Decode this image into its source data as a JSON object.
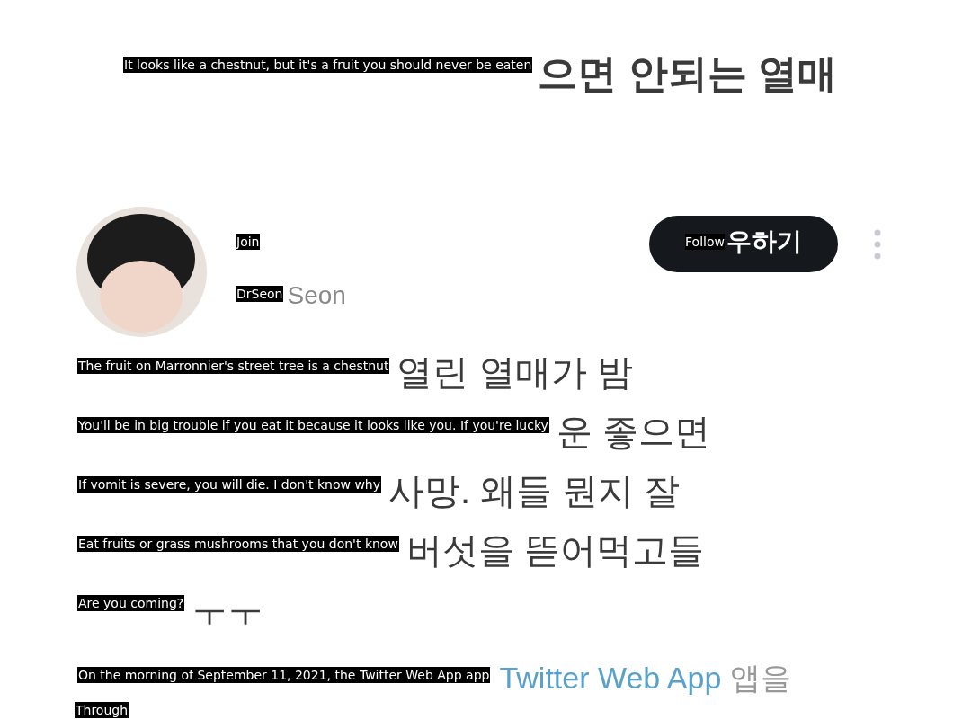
{
  "title": {
    "text": "으면 안되는 열매",
    "translation": "It looks like a chestnut, but it's a fruit you should never be eaten"
  },
  "author": {
    "name_translation": "Join",
    "handle": "Seon",
    "handle_translation": "DrSeon"
  },
  "follow_button": {
    "label": "우하기",
    "translation": "Follow"
  },
  "body": [
    {
      "text": "열린 열매가 밤",
      "translation": "The fruit on Marronnier's street tree is a chestnut"
    },
    {
      "text": "운 좋으면",
      "translation": "You'll be in big trouble if you eat it because it looks like you. If you're lucky"
    },
    {
      "text": "사망. 왜들 뭔지 잘",
      "translation": "If vomit is severe, you will die. I don't know why"
    },
    {
      "text": "버섯을 뜯어먹고들",
      "translation": "Eat fruits or grass mushrooms that you don't know"
    },
    {
      "text": "ㅜㅜ",
      "translation": "Are you coming?"
    }
  ],
  "meta": {
    "link": "Twitter Web App",
    "after": "앱을",
    "translation": "On the morning of September 11, 2021, the Twitter Web App app"
  },
  "last_line": {
    "translation": "Through"
  }
}
